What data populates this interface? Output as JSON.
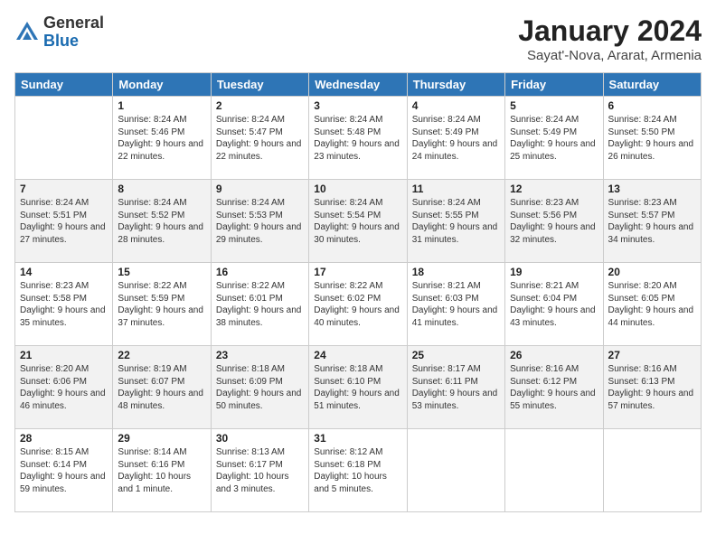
{
  "header": {
    "logo_general": "General",
    "logo_blue": "Blue",
    "month_title": "January 2024",
    "location": "Sayat'-Nova, Ararat, Armenia"
  },
  "weekdays": [
    "Sunday",
    "Monday",
    "Tuesday",
    "Wednesday",
    "Thursday",
    "Friday",
    "Saturday"
  ],
  "weeks": [
    [
      {
        "day": "",
        "sunrise": "",
        "sunset": "",
        "daylight": ""
      },
      {
        "day": "1",
        "sunrise": "Sunrise: 8:24 AM",
        "sunset": "Sunset: 5:46 PM",
        "daylight": "Daylight: 9 hours and 22 minutes."
      },
      {
        "day": "2",
        "sunrise": "Sunrise: 8:24 AM",
        "sunset": "Sunset: 5:47 PM",
        "daylight": "Daylight: 9 hours and 22 minutes."
      },
      {
        "day": "3",
        "sunrise": "Sunrise: 8:24 AM",
        "sunset": "Sunset: 5:48 PM",
        "daylight": "Daylight: 9 hours and 23 minutes."
      },
      {
        "day": "4",
        "sunrise": "Sunrise: 8:24 AM",
        "sunset": "Sunset: 5:49 PM",
        "daylight": "Daylight: 9 hours and 24 minutes."
      },
      {
        "day": "5",
        "sunrise": "Sunrise: 8:24 AM",
        "sunset": "Sunset: 5:49 PM",
        "daylight": "Daylight: 9 hours and 25 minutes."
      },
      {
        "day": "6",
        "sunrise": "Sunrise: 8:24 AM",
        "sunset": "Sunset: 5:50 PM",
        "daylight": "Daylight: 9 hours and 26 minutes."
      }
    ],
    [
      {
        "day": "7",
        "sunrise": "Sunrise: 8:24 AM",
        "sunset": "Sunset: 5:51 PM",
        "daylight": "Daylight: 9 hours and 27 minutes."
      },
      {
        "day": "8",
        "sunrise": "Sunrise: 8:24 AM",
        "sunset": "Sunset: 5:52 PM",
        "daylight": "Daylight: 9 hours and 28 minutes."
      },
      {
        "day": "9",
        "sunrise": "Sunrise: 8:24 AM",
        "sunset": "Sunset: 5:53 PM",
        "daylight": "Daylight: 9 hours and 29 minutes."
      },
      {
        "day": "10",
        "sunrise": "Sunrise: 8:24 AM",
        "sunset": "Sunset: 5:54 PM",
        "daylight": "Daylight: 9 hours and 30 minutes."
      },
      {
        "day": "11",
        "sunrise": "Sunrise: 8:24 AM",
        "sunset": "Sunset: 5:55 PM",
        "daylight": "Daylight: 9 hours and 31 minutes."
      },
      {
        "day": "12",
        "sunrise": "Sunrise: 8:23 AM",
        "sunset": "Sunset: 5:56 PM",
        "daylight": "Daylight: 9 hours and 32 minutes."
      },
      {
        "day": "13",
        "sunrise": "Sunrise: 8:23 AM",
        "sunset": "Sunset: 5:57 PM",
        "daylight": "Daylight: 9 hours and 34 minutes."
      }
    ],
    [
      {
        "day": "14",
        "sunrise": "Sunrise: 8:23 AM",
        "sunset": "Sunset: 5:58 PM",
        "daylight": "Daylight: 9 hours and 35 minutes."
      },
      {
        "day": "15",
        "sunrise": "Sunrise: 8:22 AM",
        "sunset": "Sunset: 5:59 PM",
        "daylight": "Daylight: 9 hours and 37 minutes."
      },
      {
        "day": "16",
        "sunrise": "Sunrise: 8:22 AM",
        "sunset": "Sunset: 6:01 PM",
        "daylight": "Daylight: 9 hours and 38 minutes."
      },
      {
        "day": "17",
        "sunrise": "Sunrise: 8:22 AM",
        "sunset": "Sunset: 6:02 PM",
        "daylight": "Daylight: 9 hours and 40 minutes."
      },
      {
        "day": "18",
        "sunrise": "Sunrise: 8:21 AM",
        "sunset": "Sunset: 6:03 PM",
        "daylight": "Daylight: 9 hours and 41 minutes."
      },
      {
        "day": "19",
        "sunrise": "Sunrise: 8:21 AM",
        "sunset": "Sunset: 6:04 PM",
        "daylight": "Daylight: 9 hours and 43 minutes."
      },
      {
        "day": "20",
        "sunrise": "Sunrise: 8:20 AM",
        "sunset": "Sunset: 6:05 PM",
        "daylight": "Daylight: 9 hours and 44 minutes."
      }
    ],
    [
      {
        "day": "21",
        "sunrise": "Sunrise: 8:20 AM",
        "sunset": "Sunset: 6:06 PM",
        "daylight": "Daylight: 9 hours and 46 minutes."
      },
      {
        "day": "22",
        "sunrise": "Sunrise: 8:19 AM",
        "sunset": "Sunset: 6:07 PM",
        "daylight": "Daylight: 9 hours and 48 minutes."
      },
      {
        "day": "23",
        "sunrise": "Sunrise: 8:18 AM",
        "sunset": "Sunset: 6:09 PM",
        "daylight": "Daylight: 9 hours and 50 minutes."
      },
      {
        "day": "24",
        "sunrise": "Sunrise: 8:18 AM",
        "sunset": "Sunset: 6:10 PM",
        "daylight": "Daylight: 9 hours and 51 minutes."
      },
      {
        "day": "25",
        "sunrise": "Sunrise: 8:17 AM",
        "sunset": "Sunset: 6:11 PM",
        "daylight": "Daylight: 9 hours and 53 minutes."
      },
      {
        "day": "26",
        "sunrise": "Sunrise: 8:16 AM",
        "sunset": "Sunset: 6:12 PM",
        "daylight": "Daylight: 9 hours and 55 minutes."
      },
      {
        "day": "27",
        "sunrise": "Sunrise: 8:16 AM",
        "sunset": "Sunset: 6:13 PM",
        "daylight": "Daylight: 9 hours and 57 minutes."
      }
    ],
    [
      {
        "day": "28",
        "sunrise": "Sunrise: 8:15 AM",
        "sunset": "Sunset: 6:14 PM",
        "daylight": "Daylight: 9 hours and 59 minutes."
      },
      {
        "day": "29",
        "sunrise": "Sunrise: 8:14 AM",
        "sunset": "Sunset: 6:16 PM",
        "daylight": "Daylight: 10 hours and 1 minute."
      },
      {
        "day": "30",
        "sunrise": "Sunrise: 8:13 AM",
        "sunset": "Sunset: 6:17 PM",
        "daylight": "Daylight: 10 hours and 3 minutes."
      },
      {
        "day": "31",
        "sunrise": "Sunrise: 8:12 AM",
        "sunset": "Sunset: 6:18 PM",
        "daylight": "Daylight: 10 hours and 5 minutes."
      },
      {
        "day": "",
        "sunrise": "",
        "sunset": "",
        "daylight": ""
      },
      {
        "day": "",
        "sunrise": "",
        "sunset": "",
        "daylight": ""
      },
      {
        "day": "",
        "sunrise": "",
        "sunset": "",
        "daylight": ""
      }
    ]
  ]
}
